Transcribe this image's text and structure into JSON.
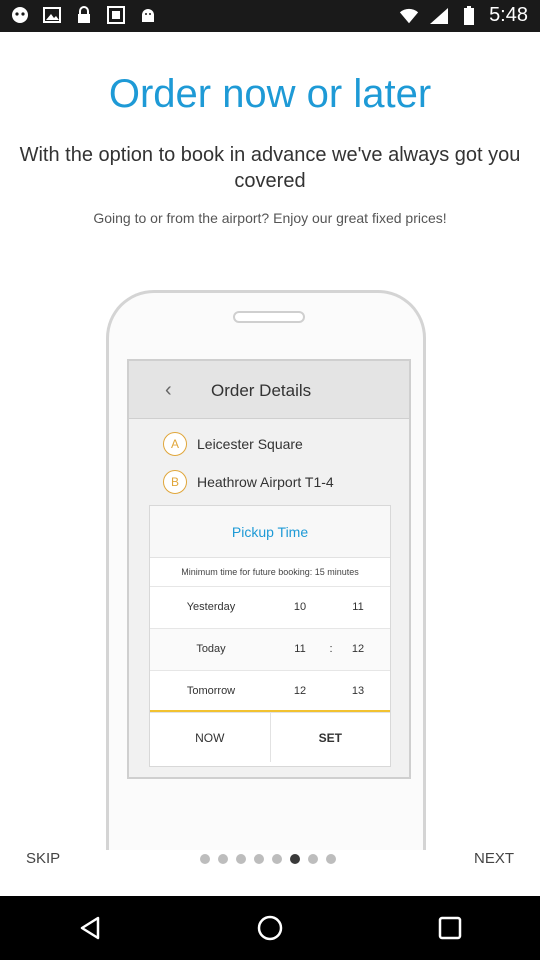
{
  "status_bar": {
    "time": "5:48",
    "icons": [
      "game-app-icon",
      "image-icon",
      "lock-icon",
      "gallery-icon",
      "android-debug-icon",
      "wifi-icon",
      "cellular-signal-icon",
      "battery-icon"
    ]
  },
  "onboarding": {
    "headline": "Order now or later",
    "subhead": "With the option to book in advance we've always got you covered",
    "tagline": "Going to or from the airport? Enjoy our great fixed prices!"
  },
  "mockup": {
    "order_title": "Order Details",
    "stops": [
      {
        "marker": "A",
        "name": "Leicester Square"
      },
      {
        "marker": "B",
        "name": "Heathrow Airport T1-4"
      }
    ],
    "picker": {
      "title": "Pickup Time",
      "note": "Minimum time for future booking: 15 minutes",
      "rows": [
        {
          "day": "Yesterday",
          "hour": "10",
          "sep": "",
          "min": "11"
        },
        {
          "day": "Today",
          "hour": "11",
          "sep": ":",
          "min": "12"
        },
        {
          "day": "Tomorrow",
          "hour": "12",
          "sep": "",
          "min": "13"
        }
      ],
      "now_label": "NOW",
      "set_label": "SET"
    }
  },
  "pager": {
    "skip_label": "SKIP",
    "next_label": "NEXT",
    "total_pages": 8,
    "current_page": 6
  },
  "system_nav": [
    "back-icon",
    "home-icon",
    "recents-icon"
  ]
}
